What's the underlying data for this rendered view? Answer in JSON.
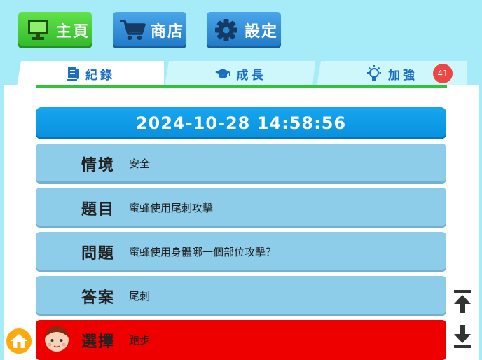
{
  "nav": {
    "home_label": "主頁",
    "shop_label": "商店",
    "settings_label": "設定"
  },
  "tabs": [
    {
      "label": "紀錄",
      "icon": "scroll-icon"
    },
    {
      "label": "成長",
      "icon": "graduation-cap-icon"
    },
    {
      "label": "加強",
      "icon": "lightbulb-icon"
    }
  ],
  "badge_count": "41",
  "record": {
    "datetime": "2024-10-28 14:58:56",
    "rows": [
      {
        "key": "情境",
        "value": "安全"
      },
      {
        "key": "題目",
        "value": "蜜蜂使用尾刺攻擊"
      },
      {
        "key": "問題",
        "value": "蜜蜂使用身體哪一個部位攻擊？"
      },
      {
        "key": "答案",
        "value": "尾刺"
      },
      {
        "key": "選擇",
        "value": "跑步"
      }
    ]
  },
  "colors": {
    "background": "#a6ecf8",
    "home_button": "#3cc332",
    "shop_button": "#2a8ad6",
    "row": "#8ecdea",
    "wrong_choice": "#ee0000",
    "badge": "#f04545",
    "header": "#0d9ae5"
  }
}
